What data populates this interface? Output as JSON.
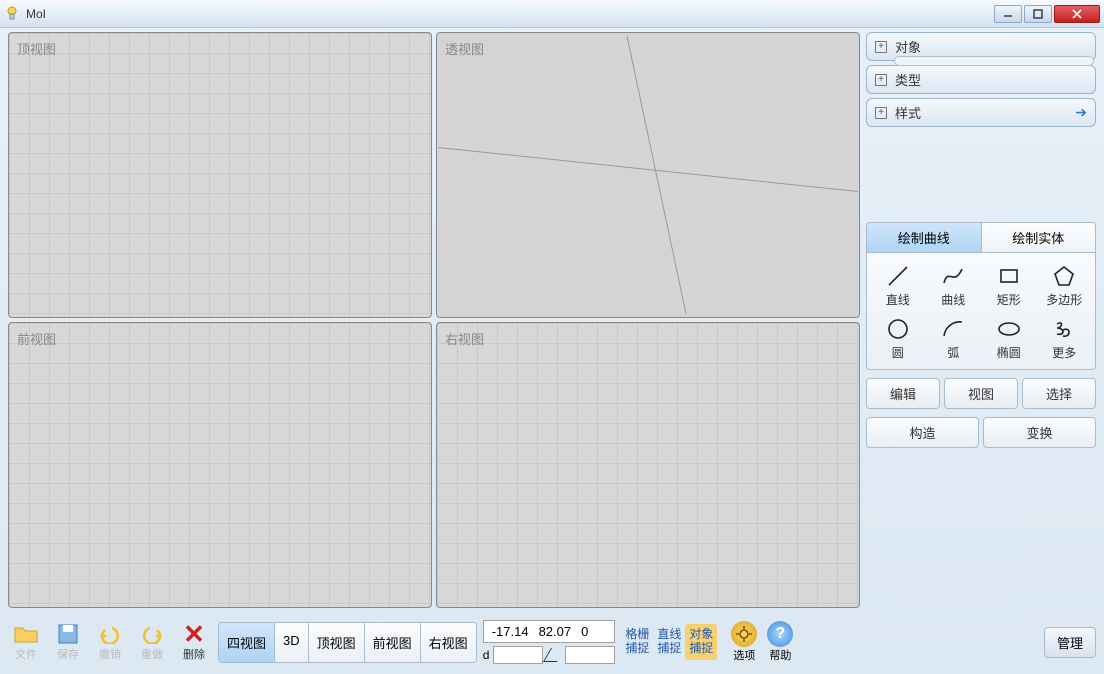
{
  "window": {
    "title": "MoI"
  },
  "viewports": {
    "top": "顶视图",
    "perspective": "透视图",
    "front": "前视图",
    "right": "右视图"
  },
  "browser": {
    "objects": "对象",
    "types": "类型",
    "styles": "样式"
  },
  "tools": {
    "tab_curve": "绘制曲线",
    "tab_solid": "绘制实体",
    "items": {
      "line": "直线",
      "curve": "曲线",
      "rect": "矩形",
      "polygon": "多边形",
      "circle": "圆",
      "arc": "弧",
      "ellipse": "椭圆",
      "more": "更多"
    },
    "edit": "编辑",
    "view": "视图",
    "select": "选择",
    "construct": "构造",
    "transform": "变换"
  },
  "bottom": {
    "file": "文件",
    "save": "保存",
    "undo": "撤销",
    "redo": "重做",
    "delete": "删除",
    "view4": "四视图",
    "view3d": "3D",
    "viewtop": "顶视图",
    "viewfront": "前视图",
    "viewright": "右视图",
    "coords": {
      "x": "-17.14",
      "y": "82.07",
      "z": "0"
    },
    "d_label": "d",
    "snap_grid": "格栅\n捕捉",
    "snap_straight": "直线\n捕捉",
    "snap_object": "对象\n捕捉",
    "options": "选项",
    "help": "帮助",
    "manage": "管理"
  }
}
